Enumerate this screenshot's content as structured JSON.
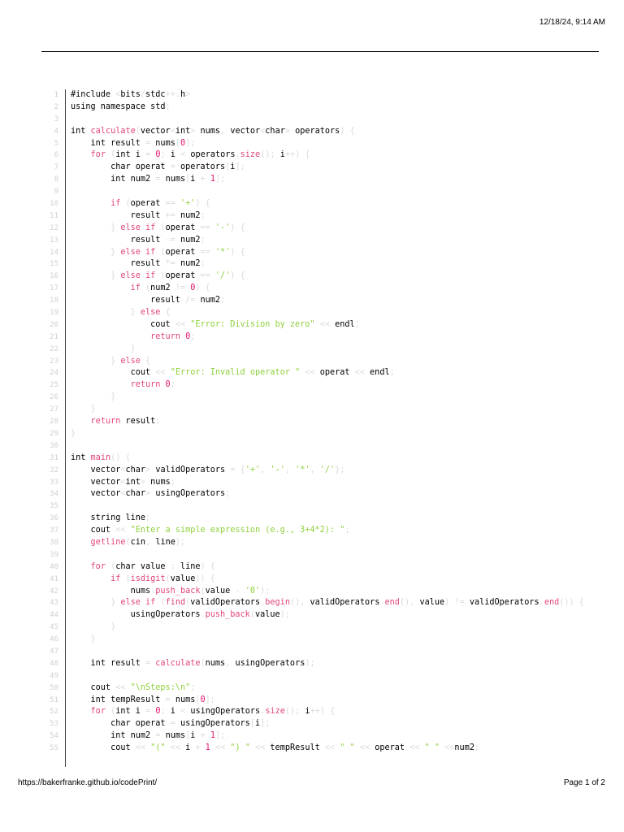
{
  "header": {
    "datetime": "12/18/24, 9:14 AM"
  },
  "footer": {
    "url": "https://bakerfranke.github.io/codePrint/",
    "page": "Page 1 of 2"
  },
  "colors": {
    "keyword": "#e0467a",
    "string": "#8fd13d",
    "number": "#e0146e",
    "punct": "#dadada",
    "line_number": "#cfcfcf"
  },
  "code": {
    "lines": [
      [
        [
          "#include ",
          ""
        ],
        [
          "<",
          "p"
        ],
        [
          "bits",
          ""
        ],
        [
          "/",
          "p"
        ],
        [
          "stdc",
          ""
        ],
        [
          "++",
          "p"
        ],
        [
          ".",
          "p"
        ],
        [
          "h",
          ""
        ],
        [
          ">",
          "p"
        ]
      ],
      [
        [
          "using namespace std",
          ""
        ],
        [
          ";",
          "p"
        ]
      ],
      [],
      [
        [
          "int ",
          ""
        ],
        [
          "calculate",
          "k"
        ],
        [
          "(",
          "p"
        ],
        [
          "vector",
          ""
        ],
        [
          "<",
          "p"
        ],
        [
          "int",
          ""
        ],
        [
          ">",
          "p"
        ],
        [
          " nums",
          ""
        ],
        [
          ", ",
          "p"
        ],
        [
          "vector",
          ""
        ],
        [
          "<",
          "p"
        ],
        [
          "char",
          ""
        ],
        [
          ">",
          "p"
        ],
        [
          " operators",
          ""
        ],
        [
          ") {",
          "p"
        ]
      ],
      [
        [
          "    int result ",
          ""
        ],
        [
          "= ",
          "p"
        ],
        [
          "nums",
          ""
        ],
        [
          "[",
          "p"
        ],
        [
          "0",
          "n"
        ],
        [
          "];",
          "p"
        ]
      ],
      [
        [
          "    ",
          ""
        ],
        [
          "for ",
          "k"
        ],
        [
          "(",
          "p"
        ],
        [
          "int i ",
          ""
        ],
        [
          "= ",
          "p"
        ],
        [
          "0",
          "n"
        ],
        [
          "; ",
          "p"
        ],
        [
          "i ",
          ""
        ],
        [
          "< ",
          "p"
        ],
        [
          "operators",
          ""
        ],
        [
          ".",
          "p"
        ],
        [
          "size",
          "k"
        ],
        [
          "(); ",
          "p"
        ],
        [
          "i",
          ""
        ],
        [
          "++) {",
          "p"
        ]
      ],
      [
        [
          "        char operat ",
          ""
        ],
        [
          "= ",
          "p"
        ],
        [
          "operators",
          ""
        ],
        [
          "[",
          "p"
        ],
        [
          "i",
          ""
        ],
        [
          "];",
          "p"
        ]
      ],
      [
        [
          "        int num2 ",
          ""
        ],
        [
          "= ",
          "p"
        ],
        [
          "nums",
          ""
        ],
        [
          "[",
          "p"
        ],
        [
          "i ",
          ""
        ],
        [
          "+ ",
          "p"
        ],
        [
          "1",
          "n"
        ],
        [
          "];",
          "p"
        ]
      ],
      [],
      [
        [
          "        ",
          ""
        ],
        [
          "if ",
          "k"
        ],
        [
          "(",
          "p"
        ],
        [
          "operat ",
          ""
        ],
        [
          "== ",
          "p"
        ],
        [
          "'+'",
          "s"
        ],
        [
          ") {",
          "p"
        ]
      ],
      [
        [
          "            result ",
          ""
        ],
        [
          "+= ",
          "p"
        ],
        [
          "num2",
          ""
        ],
        [
          ";",
          "p"
        ]
      ],
      [
        [
          "        ",
          ""
        ],
        [
          "} ",
          "p"
        ],
        [
          "else if ",
          "k"
        ],
        [
          "(",
          "p"
        ],
        [
          "operat ",
          ""
        ],
        [
          "== ",
          "p"
        ],
        [
          "'-'",
          "s"
        ],
        [
          ") {",
          "p"
        ]
      ],
      [
        [
          "            result ",
          ""
        ],
        [
          "-= ",
          "p"
        ],
        [
          "num2",
          ""
        ],
        [
          ";",
          "p"
        ]
      ],
      [
        [
          "        ",
          ""
        ],
        [
          "} ",
          "p"
        ],
        [
          "else if ",
          "k"
        ],
        [
          "(",
          "p"
        ],
        [
          "operat ",
          ""
        ],
        [
          "== ",
          "p"
        ],
        [
          "'*'",
          "s"
        ],
        [
          ") {",
          "p"
        ]
      ],
      [
        [
          "            result ",
          ""
        ],
        [
          "*= ",
          "p"
        ],
        [
          "num2",
          ""
        ],
        [
          ";",
          "p"
        ]
      ],
      [
        [
          "        ",
          ""
        ],
        [
          "} ",
          "p"
        ],
        [
          "else if ",
          "k"
        ],
        [
          "(",
          "p"
        ],
        [
          "operat ",
          ""
        ],
        [
          "== ",
          "p"
        ],
        [
          "'/'",
          "s"
        ],
        [
          ") {",
          "p"
        ]
      ],
      [
        [
          "            ",
          ""
        ],
        [
          "if ",
          "k"
        ],
        [
          "(",
          "p"
        ],
        [
          "num2 ",
          ""
        ],
        [
          "!= ",
          "p"
        ],
        [
          "0",
          "n"
        ],
        [
          ") {",
          "p"
        ]
      ],
      [
        [
          "                result ",
          ""
        ],
        [
          "/= ",
          "p"
        ],
        [
          "num2",
          ""
        ],
        [
          ";",
          "p"
        ]
      ],
      [
        [
          "            ",
          ""
        ],
        [
          "} ",
          "p"
        ],
        [
          "else ",
          "k"
        ],
        [
          "{",
          "p"
        ]
      ],
      [
        [
          "                cout ",
          ""
        ],
        [
          "<< ",
          "p"
        ],
        [
          "\"Error: Division by zero\" ",
          "s"
        ],
        [
          "<< ",
          "p"
        ],
        [
          "endl",
          ""
        ],
        [
          ";",
          "p"
        ]
      ],
      [
        [
          "                ",
          ""
        ],
        [
          "return ",
          "k"
        ],
        [
          "0",
          "n"
        ],
        [
          ";",
          "p"
        ]
      ],
      [
        [
          "            ",
          ""
        ],
        [
          "}",
          "p"
        ]
      ],
      [
        [
          "        ",
          ""
        ],
        [
          "} ",
          "p"
        ],
        [
          "else ",
          "k"
        ],
        [
          "{",
          "p"
        ]
      ],
      [
        [
          "            cout ",
          ""
        ],
        [
          "<< ",
          "p"
        ],
        [
          "\"Error: Invalid operator \" ",
          "s"
        ],
        [
          "<< ",
          "p"
        ],
        [
          "operat ",
          ""
        ],
        [
          "<< ",
          "p"
        ],
        [
          "endl",
          ""
        ],
        [
          ";",
          "p"
        ]
      ],
      [
        [
          "            ",
          ""
        ],
        [
          "return ",
          "k"
        ],
        [
          "0",
          "n"
        ],
        [
          ";",
          "p"
        ]
      ],
      [
        [
          "        ",
          ""
        ],
        [
          "}",
          "p"
        ]
      ],
      [
        [
          "    ",
          ""
        ],
        [
          "}",
          "p"
        ]
      ],
      [
        [
          "    ",
          ""
        ],
        [
          "return ",
          "k"
        ],
        [
          "result",
          ""
        ],
        [
          ";",
          "p"
        ]
      ],
      [
        [
          "}",
          "p"
        ]
      ],
      [],
      [
        [
          "int ",
          ""
        ],
        [
          "main",
          "k"
        ],
        [
          "() {",
          "p"
        ]
      ],
      [
        [
          "    vector",
          ""
        ],
        [
          "<",
          "p"
        ],
        [
          "char",
          ""
        ],
        [
          "> ",
          "p"
        ],
        [
          "validOperators ",
          ""
        ],
        [
          "= {",
          "p"
        ],
        [
          "'+'",
          "s"
        ],
        [
          ", ",
          "p"
        ],
        [
          "'-'",
          "s"
        ],
        [
          ", ",
          "p"
        ],
        [
          "'*'",
          "s"
        ],
        [
          ", ",
          "p"
        ],
        [
          "'/'",
          "s"
        ],
        [
          "};",
          "p"
        ]
      ],
      [
        [
          "    vector",
          ""
        ],
        [
          "<",
          "p"
        ],
        [
          "int",
          ""
        ],
        [
          "> ",
          "p"
        ],
        [
          "nums",
          ""
        ],
        [
          ";",
          "p"
        ]
      ],
      [
        [
          "    vector",
          ""
        ],
        [
          "<",
          "p"
        ],
        [
          "char",
          ""
        ],
        [
          "> ",
          "p"
        ],
        [
          "usingOperators",
          ""
        ],
        [
          ";",
          "p"
        ]
      ],
      [],
      [
        [
          "    string line",
          ""
        ],
        [
          ";",
          "p"
        ]
      ],
      [
        [
          "    cout ",
          ""
        ],
        [
          "<< ",
          "p"
        ],
        [
          "\"Enter a simple expression (e.g., 3+4*2): \"",
          "s"
        ],
        [
          ";",
          "p"
        ]
      ],
      [
        [
          "    ",
          ""
        ],
        [
          "getline",
          "k"
        ],
        [
          "(",
          "p"
        ],
        [
          "cin",
          ""
        ],
        [
          ", ",
          "p"
        ],
        [
          "line",
          ""
        ],
        [
          ");",
          "p"
        ]
      ],
      [],
      [
        [
          "    ",
          ""
        ],
        [
          "for ",
          "k"
        ],
        [
          "(",
          "p"
        ],
        [
          "char value ",
          ""
        ],
        [
          ": ",
          "p"
        ],
        [
          "line",
          ""
        ],
        [
          ") {",
          "p"
        ]
      ],
      [
        [
          "        ",
          ""
        ],
        [
          "if ",
          "k"
        ],
        [
          "(",
          "p"
        ],
        [
          "isdigit",
          "k"
        ],
        [
          "(",
          "p"
        ],
        [
          "value",
          ""
        ],
        [
          ")) {",
          "p"
        ]
      ],
      [
        [
          "            nums",
          ""
        ],
        [
          ".",
          "p"
        ],
        [
          "push_back",
          "k"
        ],
        [
          "(",
          "p"
        ],
        [
          "value ",
          ""
        ],
        [
          "- ",
          "p"
        ],
        [
          "'0'",
          "s"
        ],
        [
          ");",
          "p"
        ]
      ],
      [
        [
          "        ",
          ""
        ],
        [
          "} ",
          "p"
        ],
        [
          "else if ",
          "k"
        ],
        [
          "(",
          "p"
        ],
        [
          "find",
          "k"
        ],
        [
          "(",
          "p"
        ],
        [
          "validOperators",
          ""
        ],
        [
          ".",
          "p"
        ],
        [
          "begin",
          "k"
        ],
        [
          "(), ",
          "p"
        ],
        [
          "validOperators",
          ""
        ],
        [
          ".",
          "p"
        ],
        [
          "end",
          "k"
        ],
        [
          "(), ",
          "p"
        ],
        [
          "value",
          ""
        ],
        [
          ") ",
          "p"
        ],
        [
          "!= ",
          "p"
        ],
        [
          "validOperators",
          ""
        ],
        [
          ".",
          "p"
        ],
        [
          "end",
          "k"
        ],
        [
          "()) {",
          "p"
        ]
      ],
      [
        [
          "            usingOperators",
          ""
        ],
        [
          ".",
          "p"
        ],
        [
          "push_back",
          "k"
        ],
        [
          "(",
          "p"
        ],
        [
          "value",
          ""
        ],
        [
          ");",
          "p"
        ]
      ],
      [
        [
          "        ",
          ""
        ],
        [
          "}",
          "p"
        ]
      ],
      [
        [
          "    ",
          ""
        ],
        [
          "}",
          "p"
        ]
      ],
      [],
      [
        [
          "    int result ",
          ""
        ],
        [
          "= ",
          "p"
        ],
        [
          "calculate",
          "k"
        ],
        [
          "(",
          "p"
        ],
        [
          "nums",
          ""
        ],
        [
          ", ",
          "p"
        ],
        [
          "usingOperators",
          ""
        ],
        [
          ");",
          "p"
        ]
      ],
      [],
      [
        [
          "    cout ",
          ""
        ],
        [
          "<< ",
          "p"
        ],
        [
          "\"\\nSteps:\\n\"",
          "s"
        ],
        [
          ";",
          "p"
        ]
      ],
      [
        [
          "    int tempResult ",
          ""
        ],
        [
          "= ",
          "p"
        ],
        [
          "nums",
          ""
        ],
        [
          "[",
          "p"
        ],
        [
          "0",
          "n"
        ],
        [
          "];",
          "p"
        ]
      ],
      [
        [
          "    ",
          ""
        ],
        [
          "for ",
          "k"
        ],
        [
          "(",
          "p"
        ],
        [
          "int i ",
          ""
        ],
        [
          "= ",
          "p"
        ],
        [
          "0",
          "n"
        ],
        [
          "; ",
          "p"
        ],
        [
          "i ",
          ""
        ],
        [
          "< ",
          "p"
        ],
        [
          "usingOperators",
          ""
        ],
        [
          ".",
          "p"
        ],
        [
          "size",
          "k"
        ],
        [
          "(); ",
          "p"
        ],
        [
          "i",
          ""
        ],
        [
          "++) {",
          "p"
        ]
      ],
      [
        [
          "        char operat ",
          ""
        ],
        [
          "= ",
          "p"
        ],
        [
          "usingOperators",
          ""
        ],
        [
          "[",
          "p"
        ],
        [
          "i",
          ""
        ],
        [
          "];",
          "p"
        ]
      ],
      [
        [
          "        int num2 ",
          ""
        ],
        [
          "= ",
          "p"
        ],
        [
          "nums",
          ""
        ],
        [
          "[",
          "p"
        ],
        [
          "i ",
          ""
        ],
        [
          "+ ",
          "p"
        ],
        [
          "1",
          "n"
        ],
        [
          "];",
          "p"
        ]
      ],
      [
        [
          "        cout ",
          ""
        ],
        [
          "<< ",
          "p"
        ],
        [
          "\"(\" ",
          "s"
        ],
        [
          "<< ",
          "p"
        ],
        [
          "i ",
          ""
        ],
        [
          "+ ",
          "p"
        ],
        [
          "1 ",
          "n"
        ],
        [
          "<< ",
          "p"
        ],
        [
          "\") \" ",
          "s"
        ],
        [
          "<< ",
          "p"
        ],
        [
          "tempResult ",
          ""
        ],
        [
          "<< ",
          "p"
        ],
        [
          "\" \" ",
          "s"
        ],
        [
          "<< ",
          "p"
        ],
        [
          "operat ",
          ""
        ],
        [
          "<< ",
          "p"
        ],
        [
          "\" \" ",
          "s"
        ],
        [
          "<<",
          "p"
        ],
        [
          "num2",
          ""
        ],
        [
          ";",
          "p"
        ]
      ]
    ]
  }
}
